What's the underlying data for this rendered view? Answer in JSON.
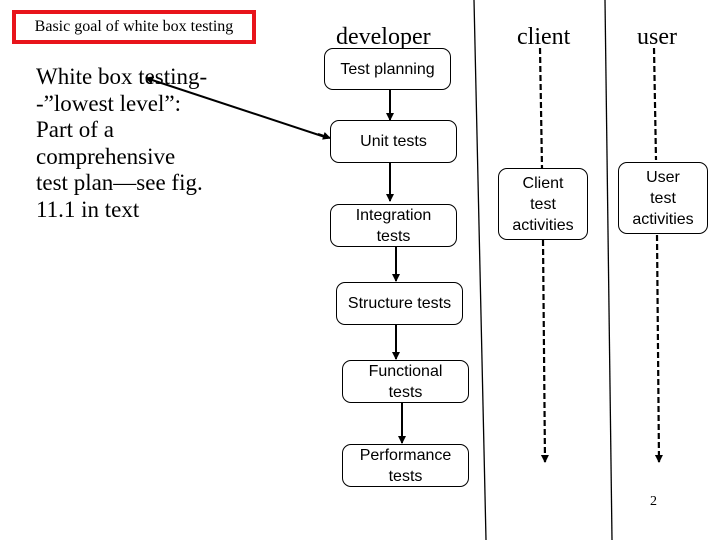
{
  "slide": {
    "title": "Basic goal of white box testing",
    "title_border_color": "#e8141b",
    "body_text": "White box testing-\n-”lowest level”:\nPart of a\ncomprehensive\ntest plan—see fig.\n11.1 in text",
    "page_number": "2"
  },
  "lanes": {
    "developer": "developer",
    "client": "client",
    "user": "user"
  },
  "developer_steps": [
    {
      "id": "test-planning",
      "label": "Test planning"
    },
    {
      "id": "unit-tests",
      "label": "Unit tests"
    },
    {
      "id": "integration-tests",
      "label": "Integration\ntests"
    },
    {
      "id": "structure-tests",
      "label": "Structure tests"
    },
    {
      "id": "functional-tests",
      "label": "Functional\ntests"
    },
    {
      "id": "performance-tests",
      "label": "Performance\ntests"
    }
  ],
  "client_activity": {
    "label": "Client\ntest\nactivities"
  },
  "user_activity": {
    "label": "User\ntest\nactivities"
  },
  "annotation": {
    "from": "White box testing",
    "to": "Unit tests"
  }
}
